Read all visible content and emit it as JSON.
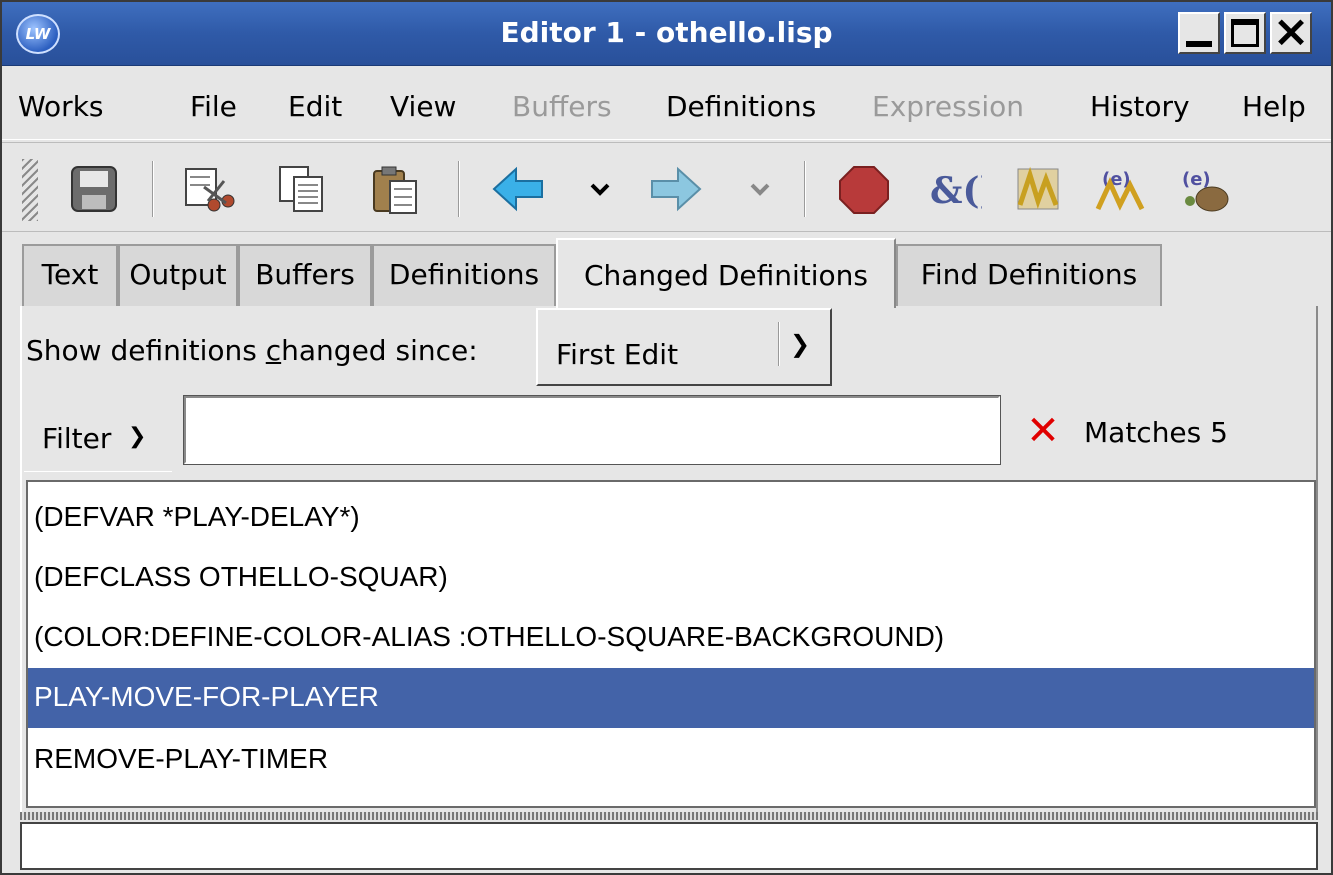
{
  "window": {
    "title": "Editor 1 - othello.lisp",
    "app_icon_text": "LW"
  },
  "menubar": {
    "items": [
      {
        "label": "Works",
        "enabled": true
      },
      {
        "label": "File",
        "enabled": true
      },
      {
        "label": "Edit",
        "enabled": true
      },
      {
        "label": "View",
        "enabled": true
      },
      {
        "label": "Buffers",
        "enabled": false
      },
      {
        "label": "Definitions",
        "enabled": true
      },
      {
        "label": "Expression",
        "enabled": false
      },
      {
        "label": "History",
        "enabled": true
      },
      {
        "label": "Help",
        "enabled": true
      }
    ]
  },
  "toolbar": {
    "icons": [
      "save-icon",
      "cut-icon",
      "copy-icon",
      "paste-icon",
      "back-arrow-icon",
      "back-history-dropdown-icon",
      "forward-arrow-icon",
      "forward-history-dropdown-icon",
      "stop-icon",
      "inspect-icon",
      "evaluate-definition-icon",
      "evaluate-region-icon",
      "evaluate-buffer-icon"
    ]
  },
  "tabs": [
    {
      "label": "Text"
    },
    {
      "label": "Output"
    },
    {
      "label": "Buffers"
    },
    {
      "label": "Definitions"
    },
    {
      "label": "Changed Definitions",
      "active": true
    },
    {
      "label": "Find Definitions"
    }
  ],
  "changed": {
    "since_label_pre": "Show definitions ",
    "since_label_accel": "c",
    "since_label_post": "hanged since:",
    "since_value": "First Edit"
  },
  "filter": {
    "label": "Filter",
    "value": "",
    "clear_symbol": "✕",
    "matches_text": "Matches 5"
  },
  "definitions": [
    "(DEFVAR *PLAY-DELAY*)",
    "(DEFCLASS OTHELLO-SQUAR)",
    "(COLOR:DEFINE-COLOR-ALIAS :OTHELLO-SQUARE-BACKGROUND)",
    "PLAY-MOVE-FOR-PLAYER",
    "REMOVE-PLAY-TIMER"
  ],
  "selected_definition": "PLAY-MOVE-FOR-PLAYER",
  "colors": {
    "titlebar": "#2f5aa8",
    "selection": "#4363a8",
    "clear_x": "#e00000"
  }
}
